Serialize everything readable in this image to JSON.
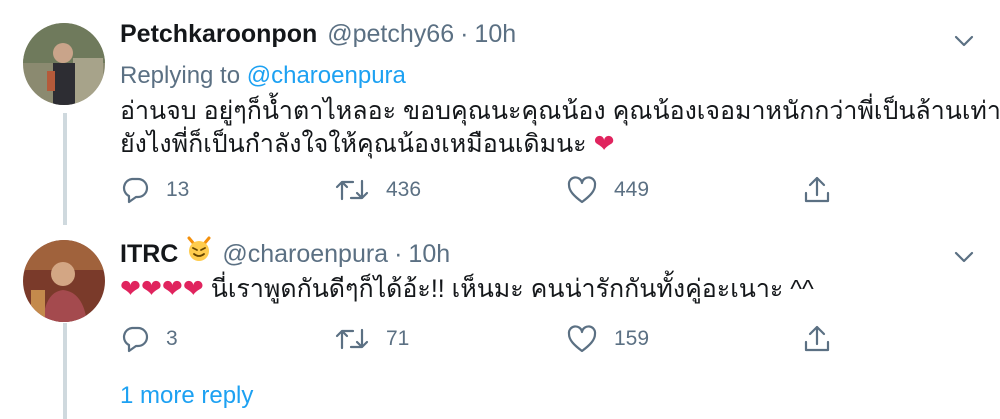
{
  "tweet1": {
    "name": "Petchkaroonpon",
    "handle": "@petchy66",
    "dot": "·",
    "time": "10h",
    "replying_prefix": "Replying to ",
    "replying_to": "@charoenpura",
    "line1": "อ่านจบ อยู่ๆก็น้ำตาไหลอะ ขอบคุณนะคุณน้อง คุณน้องเจอมาหนักกว่าพี่เป็นล้านเท่า",
    "line2": "ยังไงพี่ก็เป็นกำลังใจให้คุณน้องเหมือนเดิมนะ",
    "heart": "❤",
    "replies": "13",
    "retweets": "436",
    "likes": "449",
    "icons": [
      "more-chevron-icon",
      "reply-icon",
      "retweet-icon",
      "like-icon",
      "share-icon"
    ]
  },
  "tweet2": {
    "name": "ITRC",
    "badge_icon": "smiling-devil-emoji",
    "handle": "@charoenpura",
    "dot": "·",
    "time": "10h",
    "hearts": "❤❤❤❤",
    "text": "นี่เราพูดกันดีๆก็ได้อ้ะ!! เห็นมะ คนน่ารักกันทั้งคู่อะเนาะ ^^",
    "replies": "3",
    "retweets": "71",
    "likes": "159"
  },
  "more_replies": "1 more reply",
  "colors": {
    "link": "#1da1f2",
    "secondary": "#5b7083",
    "heart": "#e0245e",
    "thread_line": "#cfd9de"
  }
}
